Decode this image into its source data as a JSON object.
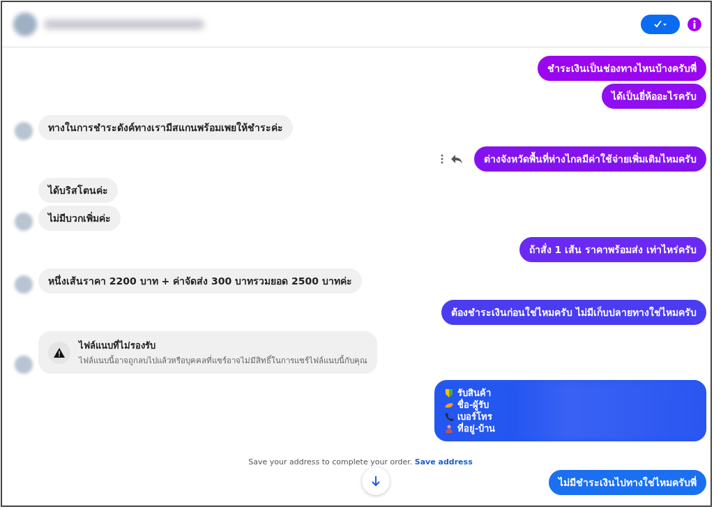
{
  "header": {
    "status_button": {
      "selected": true
    },
    "info_button": {
      "color": "#a100f2"
    }
  },
  "groups": [
    {
      "kind": "out",
      "messages": [
        {
          "kind": "text",
          "text": "ชำระเงินเป็นช่องทางไหนบ้างครับพี่",
          "color": "#9a06f0"
        },
        {
          "kind": "text",
          "text": "ได้เป็นยี่ห้ออะไรครับ",
          "color": "#900ef0"
        }
      ]
    },
    {
      "kind": "in",
      "avatar": true,
      "messages": [
        {
          "kind": "text",
          "text": "ทางในการชำระดังค์ทางเรามีสแกนพร้อมเพยให้ชำระค่ะ"
        }
      ]
    },
    {
      "kind": "out",
      "messages": [
        {
          "kind": "text",
          "text": "ต่างจังหวัดพื้นที่ห่างไกลมีค่าใช้จ่ายเพิ่มเติมไหมครับ",
          "color": "#8412ee",
          "hovered": true
        }
      ]
    },
    {
      "kind": "in",
      "avatar": true,
      "messages": [
        {
          "kind": "text",
          "text": "ได้บริสโตนค่ะ"
        },
        {
          "kind": "text",
          "text": "ไม่มีบวกเพิ่มค่ะ"
        }
      ]
    },
    {
      "kind": "out",
      "messages": [
        {
          "kind": "text",
          "text": "ถ้าสั่ง 1 เส้น ราคาพร้อมส่ง เท่าไหร่ครับ",
          "color": "#6a2af2"
        }
      ]
    },
    {
      "kind": "in",
      "avatar": true,
      "messages": [
        {
          "kind": "text",
          "text": "หนึ่งเส้นราคา 2200 บาท + ค่าจัดส่ง 300 บาทรวมยอด 2500 บาทค่ะ"
        }
      ]
    },
    {
      "kind": "out",
      "messages": [
        {
          "kind": "text",
          "text": "ต้องชำระเงินก่อนใช่ไหมครับ ไม่มีเก็บปลายทางใช่ไหมครับ",
          "color": "#4a3cf0"
        }
      ]
    },
    {
      "kind": "in",
      "avatar": true,
      "messages": [
        {
          "kind": "notice",
          "title": "ไฟล์แนบที่ไม่รองรับ",
          "text": "ไฟล์แนบนี้อาจถูกลบไปแล้วหรือบุคคลที่แชร์อาจไม่มีสิทธิ์ในการแชร์ไฟล์แนบนี้กับคุณ"
        }
      ]
    },
    {
      "kind": "out",
      "messages": [
        {
          "kind": "redacted_list",
          "color": "#2456f0",
          "lines": [
            "รับสินค้า",
            "ชื่อ-ผู้รับ",
            "เบอร์โทร",
            "ที่อยู่-บ้าน"
          ]
        }
      ]
    }
  ],
  "address_prompt": {
    "text": "Save your address to complete your order.",
    "link": "Save address"
  },
  "last_group": {
    "kind": "out",
    "messages": [
      {
        "kind": "text",
        "text": "ไม่มีชำระเงินไปทางใช่ไหมครับพี่",
        "color": "#1a70f0"
      }
    ]
  }
}
